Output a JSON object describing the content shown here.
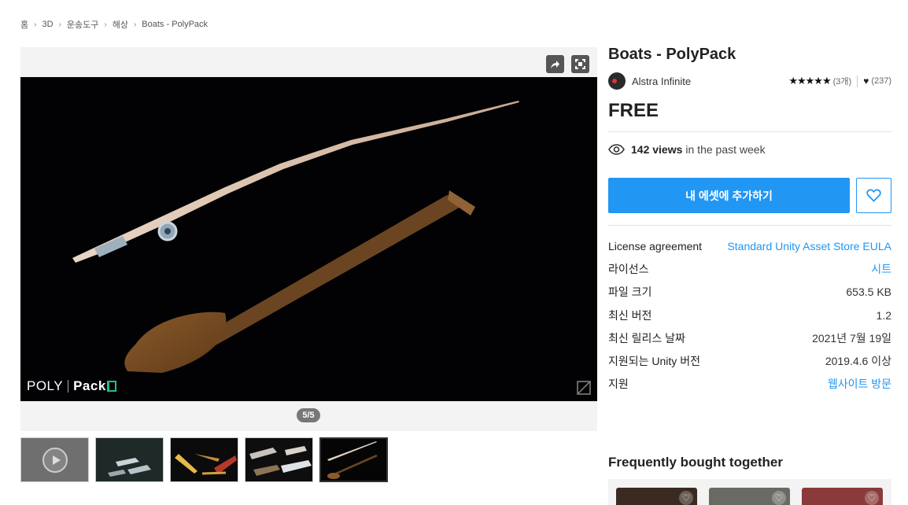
{
  "breadcrumb": [
    "홈",
    "3D",
    "운송도구",
    "해상",
    "Boats - PolyPack"
  ],
  "viewer": {
    "pager": "5/5",
    "logo_poly": "POLY",
    "logo_pack": "Pack",
    "thumbnails": [
      {
        "label": "video-thumbnail"
      },
      {
        "label": "boats-thumbnail"
      },
      {
        "label": "kayaks-thumbnail"
      },
      {
        "label": "boats-set-thumbnail"
      },
      {
        "label": "fishing-rod-paddle-thumbnail"
      }
    ]
  },
  "product": {
    "title": "Boats - PolyPack",
    "publisher": "Alstra Infinite",
    "stars": "★★★★★",
    "rating_count": "(3개)",
    "favorites": "(237)",
    "price": "FREE",
    "views_count": "142 views",
    "views_suffix": "in the past week",
    "add_button": "내 에셋에 추가하기"
  },
  "details": [
    {
      "key": "License agreement",
      "value": "Standard Unity Asset Store EULA",
      "link": true
    },
    {
      "key": "라이선스",
      "value": "시트",
      "link": true
    },
    {
      "key": "파일 크기",
      "value": "653.5 KB",
      "link": false
    },
    {
      "key": "최신 버전",
      "value": "1.2",
      "link": false
    },
    {
      "key": "최신 릴리스 날짜",
      "value": "2021년 7월 19일",
      "link": false
    },
    {
      "key": "지원되는 Unity 버전",
      "value": "2019.4.6 이상",
      "link": false
    },
    {
      "key": "지원",
      "value": "웹사이트 방문",
      "link": true
    }
  ],
  "frequently_bought": {
    "heading": "Frequently bought together"
  },
  "colors": {
    "accent": "#2196f3",
    "viewer_bg": "#020204"
  }
}
